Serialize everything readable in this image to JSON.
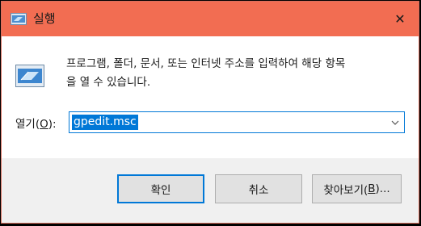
{
  "window": {
    "title": "실행",
    "close_glyph": "✕"
  },
  "description": {
    "line1": "프로그램, 폴더, 문서, 또는 인터넷 주소를 입력하여 해당 항목",
    "line2": "을 열 수 있습니다."
  },
  "open": {
    "label_prefix": "열기(",
    "label_hotkey": "O",
    "label_suffix": "):",
    "value": "gpedit.msc"
  },
  "buttons": {
    "ok_label": "확인",
    "cancel_label": "취소",
    "browse_prefix": "찾아보기(",
    "browse_hotkey": "B",
    "browse_suffix": ")..."
  },
  "colors": {
    "titlebar": "#f26d52",
    "accent": "#0078d7",
    "footer": "#f0f0f0"
  },
  "icons": {
    "title": "run-app-icon",
    "body": "run-app-icon",
    "close": "close-icon",
    "dropdown": "chevron-down-icon"
  }
}
